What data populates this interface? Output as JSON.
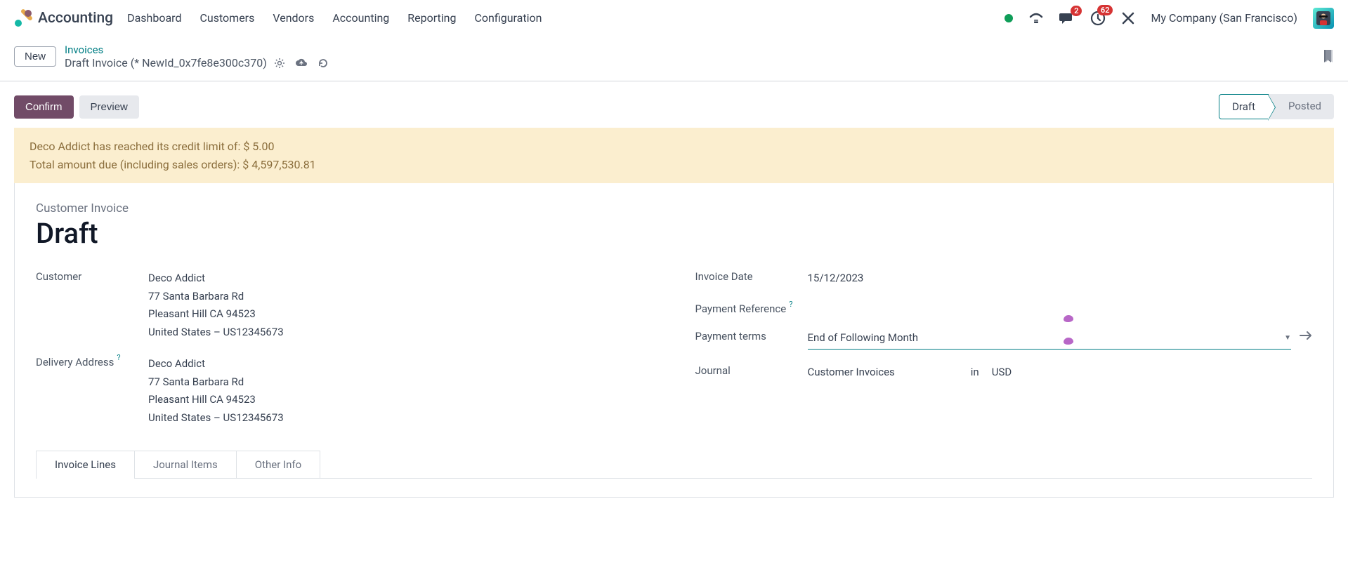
{
  "app": {
    "title": "Accounting"
  },
  "nav": {
    "items": [
      "Dashboard",
      "Customers",
      "Vendors",
      "Accounting",
      "Reporting",
      "Configuration"
    ]
  },
  "header": {
    "messages_badge": "2",
    "activities_badge": "62",
    "company": "My Company (San Francisco)"
  },
  "breadcrumb": {
    "new_label": "New",
    "parent": "Invoices",
    "current": "Draft Invoice (* NewId_0x7fe8e300c370)"
  },
  "actions": {
    "confirm": "Confirm",
    "preview": "Preview"
  },
  "status": {
    "draft": "Draft",
    "posted": "Posted"
  },
  "alert": {
    "line1": "Deco Addict has reached its credit limit of: $ 5.00",
    "line2": "Total amount due (including sales orders): $ 4,597,530.81"
  },
  "form": {
    "doc_type": "Customer Invoice",
    "doc_title": "Draft",
    "customer_label": "Customer",
    "customer": {
      "name": "Deco Addict",
      "street": "77 Santa Barbara Rd",
      "city": "Pleasant Hill CA 94523",
      "country": "United States – US12345673"
    },
    "delivery_label": "Delivery Address",
    "delivery": {
      "name": "Deco Addict",
      "street": "77 Santa Barbara Rd",
      "city": "Pleasant Hill CA 94523",
      "country": "United States – US12345673"
    },
    "invoice_date_label": "Invoice Date",
    "invoice_date": "15/12/2023",
    "payment_ref_label": "Payment Reference",
    "payment_ref": "",
    "payment_terms_label": "Payment terms",
    "payment_terms": "End of Following Month",
    "journal_label": "Journal",
    "journal": "Customer Invoices",
    "journal_in": "in",
    "journal_currency": "USD"
  },
  "tabs": {
    "items": [
      "Invoice Lines",
      "Journal Items",
      "Other Info"
    ]
  }
}
